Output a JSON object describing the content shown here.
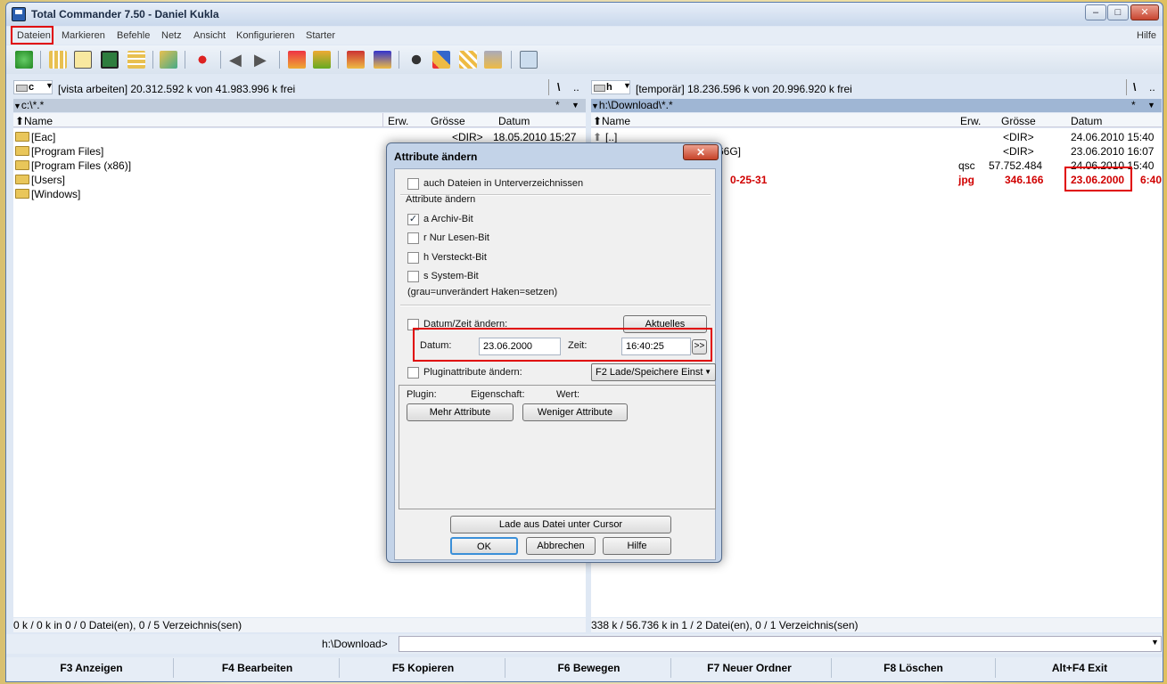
{
  "window": {
    "title": "Total Commander 7.50 - Daniel Kukla",
    "btn_min": "–",
    "btn_max": "□",
    "btn_close": "✕"
  },
  "menu": {
    "items": [
      "Dateien",
      "Markieren",
      "Befehle",
      "Netz",
      "Ansicht",
      "Konfigurieren",
      "Starter"
    ],
    "help": "Hilfe"
  },
  "left": {
    "drive": "c",
    "drive_info": "[vista arbeiten]  20.312.592 k von 41.983.996 k frei",
    "root_btn": "\\",
    "up_btn": "..",
    "path": "c:\\*.*",
    "filter": "*",
    "col_name": "Name",
    "col_ext": "Erw.",
    "col_size": "Grösse",
    "col_date": "Datum",
    "rows": [
      {
        "name": "[Eac]",
        "size": "<DIR>",
        "date": "18.05.2010 15:27"
      },
      {
        "name": "[Program Files]"
      },
      {
        "name": "[Program Files (x86)]"
      },
      {
        "name": "[Users]"
      },
      {
        "name": "[Windows]"
      }
    ],
    "status": "0 k / 0 k in 0 / 0 Datei(en), 0 / 5 Verzeichnis(sen)"
  },
  "right": {
    "drive": "h",
    "drive_info": "[temporär]  18.236.596 k von 20.996.920 k frei",
    "root_btn": "\\",
    "up_btn": "..",
    "path": "h:\\Download\\*.*",
    "filter": "*",
    "col_name": "Name",
    "col_ext": "Erw.",
    "col_size": "Grösse",
    "col_date": "Datum",
    "rows": [
      {
        "name": "[..]",
        "ext": "",
        "size": "<DIR>",
        "date": "24.06.2010 15:40"
      },
      {
        "name": "66G]",
        "ext": "",
        "size": "<DIR>",
        "date": "23.06.2010 16:07"
      },
      {
        "name": "",
        "ext": "qsc",
        "size": "57.752.484",
        "date": "24.06.2010 15:40"
      },
      {
        "name": "0-25-31",
        "ext": "jpg",
        "size": "346.166",
        "date": "23.06.2000",
        "time": "6:40"
      }
    ],
    "status": "338 k / 56.736 k in 1 / 2 Datei(en), 0 / 1 Verzeichnis(sen)"
  },
  "cmdline": {
    "path": "h:\\Download>"
  },
  "fkeys": [
    "F3 Anzeigen",
    "F4 Bearbeiten",
    "F5 Kopieren",
    "F6 Bewegen",
    "F7 Neuer Ordner",
    "F8 Löschen",
    "Alt+F4 Exit"
  ],
  "dialog": {
    "title": "Attribute ändern",
    "close": "✕",
    "subdirs_label": "auch Dateien in Unterverzeichnissen",
    "group_label": "Attribute ändern",
    "attr_archive": "a  Archiv-Bit",
    "attr_readonly": "r  Nur Lesen-Bit",
    "attr_hidden": "h  Versteckt-Bit",
    "attr_system": "s  System-Bit",
    "legend": "(grau=unverändert  Haken=setzen)",
    "datetime_label": "Datum/Zeit ändern:",
    "current_btn": "Aktuelles",
    "date_label": "Datum:",
    "date_value": "23.06.2000",
    "time_label": "Zeit:",
    "time_value": "16:40:25",
    "more_btn": ">>",
    "plugin_label": "Pluginattribute ändern:",
    "plugin_select": "F2 Lade/Speichere Einst",
    "col_plugin": "Plugin:",
    "col_property": "Eigenschaft:",
    "col_value": "Wert:",
    "more_attr_btn": "Mehr Attribute",
    "less_attr_btn": "Weniger Attribute",
    "load_btn": "Lade aus Datei unter Cursor",
    "ok_btn": "OK",
    "cancel_btn": "Abbrechen",
    "help_btn": "Hilfe",
    "archive_checked": true
  },
  "colors": {
    "highlight": "#e00000",
    "selected_file": "#d00000"
  }
}
